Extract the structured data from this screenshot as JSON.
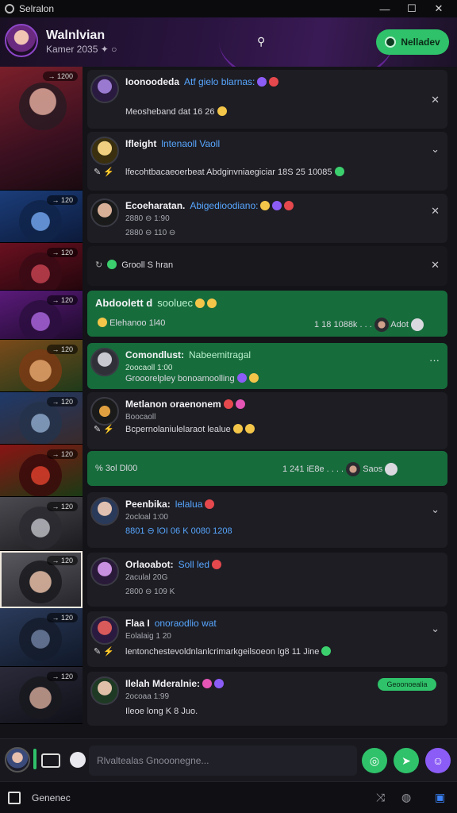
{
  "titlebar": {
    "title": "Selralon",
    "minimize": "—",
    "maximize": "☐",
    "close": "✕"
  },
  "header": {
    "name": "Walnlvian",
    "subtitle": "Kamer 2035   ✦ ○",
    "search_icon": "⚲",
    "cta_label": "Nelladev"
  },
  "strip": {
    "tiles": [
      {
        "tag": "→ 1200"
      },
      {
        "tag": "→ 120"
      },
      {
        "tag": "→ 120"
      },
      {
        "tag": "→ 120"
      },
      {
        "tag": "→ 120"
      },
      {
        "tag": "→ 120"
      },
      {
        "tag": "→ 120"
      },
      {
        "tag": "→ 120"
      },
      {
        "tag": "→ 120"
      },
      {
        "tag": "→ 120"
      },
      {
        "tag": "→ 120"
      },
      {
        "tag": "→ 120"
      }
    ]
  },
  "messages": [
    {
      "title": "Ioonoodeda",
      "accent": "Atf gielo blarnas:",
      "line2": "Meosheband dat 16 26",
      "right": "✕"
    },
    {
      "title": "Ifleight",
      "accent": "lntenaoll Vaoll",
      "line3": "lfecohtbacaeoerbeat Abdginvniaegiciar 18S 25 10085",
      "right": "⌄"
    },
    {
      "title": "Ecoeharatan.",
      "accent": "Abigedioodiano:",
      "line2": "2880 ⊖ 1:90",
      "line3": "2880 ⊖ 110 ⊖",
      "right": "✕"
    },
    {
      "line": "Grooll S hran",
      "right": "✕"
    },
    {
      "title": "Abdoolett d",
      "accent": "sooluec",
      "line3": "Elehanoo 1l40",
      "meta": "1 18 1088k  . . .",
      "meta_name": "Adot"
    },
    {
      "title": "Comondlust:",
      "accent": "Nabeemitragal",
      "line2": "2oocaoll 1:00",
      "line3": "Grooorelpley bonoamoolling",
      "right": "···"
    },
    {
      "title": "Metlanon oraenonem",
      "line2": "Boocaoll",
      "line3": "Bcpernolaniulelaraot lealue"
    },
    {
      "line": "% 3ol Dl00",
      "meta": "1 241 iE8e  . . . .",
      "meta_name": "Saos"
    },
    {
      "title": "Peenbika:",
      "accent": "lelalua",
      "line2": "2ocloal 1:00",
      "line3": "8801 ⊖ lOI 06 K 0080 1208",
      "right": "⌄"
    },
    {
      "title": "Orlaoabot:",
      "accent": "Soll led",
      "line2": "2aculal 20G",
      "line3": "2800 ⊖ 109 K"
    },
    {
      "title": "Flaa I",
      "accent": "onoraodlio wat",
      "line2": "Eolalaig 1 20",
      "line3": "lentonchestevoldnlanlcrimarkgeilsoeon lg8 11 Jine",
      "right": "⌄"
    },
    {
      "title": "Ilelah Mderalnie:",
      "line2": "2ocoaa 1:99",
      "line3": "Ileoe long K 8 Juo.",
      "badge": "Geoonoealia"
    }
  ],
  "composer": {
    "placeholder": "Rlvaltealas Gnooonegne..."
  },
  "bottombar": {
    "label": "Genenec"
  }
}
